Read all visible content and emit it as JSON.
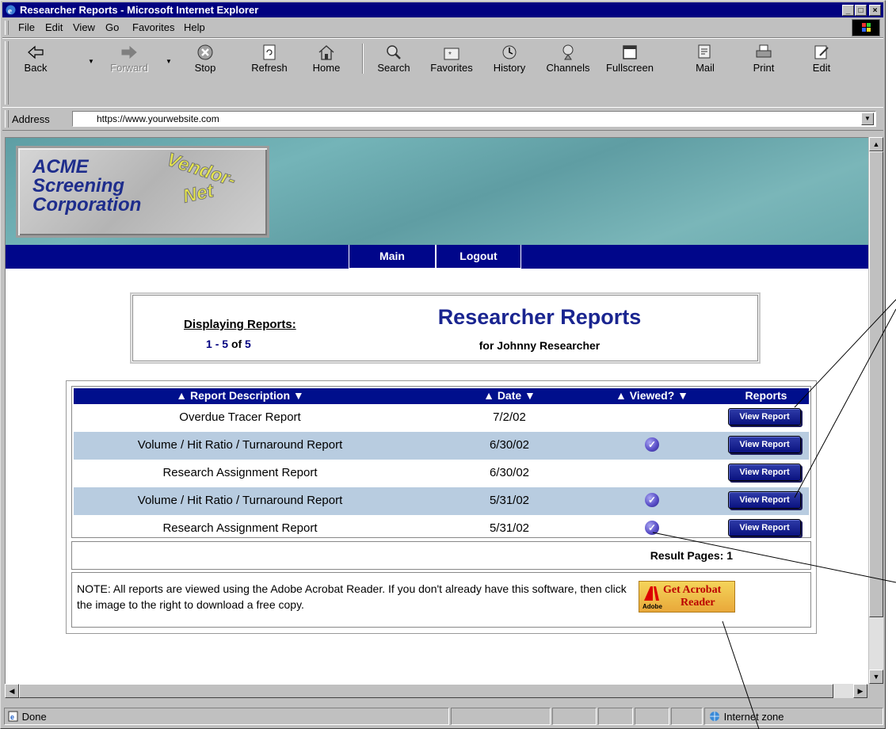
{
  "window": {
    "title": "Researcher Reports - Microsoft Internet Explorer",
    "caption_buttons": [
      "minimize",
      "maximize",
      "close"
    ]
  },
  "menu": [
    "File",
    "Edit",
    "View",
    "Go",
    "Favorites",
    "Help"
  ],
  "toolbar": {
    "buttons": [
      {
        "label": "Back",
        "icon": "back-arrow-icon"
      },
      {
        "label": "Forward",
        "icon": "forward-arrow-icon",
        "disabled": true
      },
      {
        "label": "Stop",
        "icon": "stop-icon"
      },
      {
        "label": "Refresh",
        "icon": "refresh-icon"
      },
      {
        "label": "Home",
        "icon": "home-icon"
      },
      {
        "label": "Search",
        "icon": "search-icon"
      },
      {
        "label": "Favorites",
        "icon": "favorites-icon"
      },
      {
        "label": "History",
        "icon": "history-icon"
      },
      {
        "label": "Channels",
        "icon": "channels-icon"
      },
      {
        "label": "Fullscreen",
        "icon": "fullscreen-icon"
      },
      {
        "label": "Mail",
        "icon": "mail-icon"
      },
      {
        "label": "Print",
        "icon": "print-icon"
      },
      {
        "label": "Edit",
        "icon": "edit-icon"
      }
    ]
  },
  "address": {
    "label": "Address",
    "url": "https://www.yourwebsite.com"
  },
  "banner": {
    "logo_lines": [
      "ACME",
      "Screening",
      "Corporation"
    ],
    "logo_script": [
      "Vendor-",
      "Net"
    ]
  },
  "nav": {
    "main": "Main",
    "logout": "Logout"
  },
  "header": {
    "displaying_label": "Displaying Reports:",
    "range_start": "1",
    "range_end": "5",
    "range_of": "of",
    "range_total": "5",
    "title": "Researcher Reports",
    "subtitle": "for Johnny Researcher"
  },
  "table": {
    "columns": {
      "description": "▲ Report Description ▼",
      "date": "▲ Date ▼",
      "viewed": "▲ Viewed? ▼",
      "reports": "Reports"
    },
    "rows": [
      {
        "description": "Overdue Tracer Report",
        "date": "7/2/02",
        "viewed": false,
        "button": "View Report"
      },
      {
        "description": "Volume / Hit Ratio / Turnaround Report",
        "date": "6/30/02",
        "viewed": true,
        "button": "View Report"
      },
      {
        "description": "Research Assignment Report",
        "date": "6/30/02",
        "viewed": false,
        "button": "View Report"
      },
      {
        "description": "Volume / Hit Ratio / Turnaround Report",
        "date": "5/31/02",
        "viewed": true,
        "button": "View Report"
      },
      {
        "description": "Research Assignment Report",
        "date": "5/31/02",
        "viewed": true,
        "button": "View Report"
      }
    ]
  },
  "result_pages": "Result Pages: 1",
  "note": "NOTE: All reports are viewed using the Adobe Acrobat Reader.  If you don't already have this software, then click the image to the right to download a free copy.",
  "acrobat": {
    "line1": "Get Acrobat",
    "line2": "Reader",
    "brand": "Adobe"
  },
  "status": {
    "text": "Done",
    "zone": "Internet zone"
  },
  "colors": {
    "nav_bar": "#00068a",
    "title_bar": "#000080",
    "alt_row": "#b8cce0",
    "title_text": "#1a2590"
  }
}
